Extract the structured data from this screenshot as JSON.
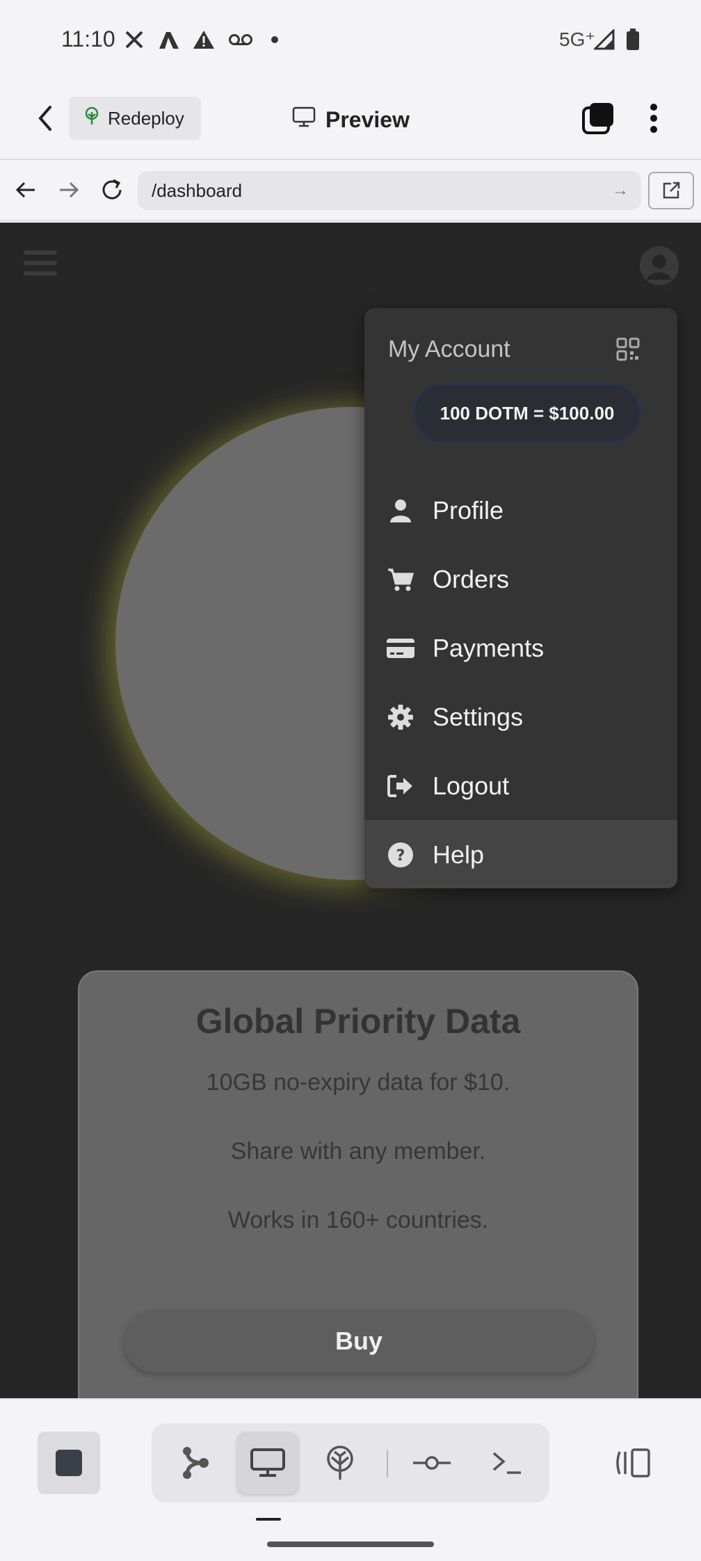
{
  "status_bar": {
    "time": "11:10",
    "network": "5G⁺",
    "icons": [
      "x-icon",
      "app-icon",
      "warning-icon",
      "voicemail-icon",
      "dot-icon",
      "signal-icon",
      "battery-icon"
    ]
  },
  "app_bar": {
    "redeploy_label": "Redeploy",
    "preview_label": "Preview"
  },
  "browser": {
    "url": "/dashboard"
  },
  "account_menu": {
    "title": "My Account",
    "balance": "100 DOTM = $100.00",
    "items": [
      {
        "label": "Profile",
        "icon": "user-icon"
      },
      {
        "label": "Orders",
        "icon": "cart-icon"
      },
      {
        "label": "Payments",
        "icon": "credit-card-icon"
      },
      {
        "label": "Settings",
        "icon": "gear-icon"
      },
      {
        "label": "Logout",
        "icon": "logout-icon"
      },
      {
        "label": "Help",
        "icon": "help-icon"
      }
    ]
  },
  "product": {
    "title": "Global Priority Data",
    "lines": [
      "10GB no-expiry data for $10.",
      "Share with any member.",
      "Works in 160+ countries."
    ],
    "buy_label": "Buy"
  },
  "colors": {
    "accent_glow": "#d2d23c",
    "menu_bg": "#343434",
    "page_bg": "#262626"
  }
}
